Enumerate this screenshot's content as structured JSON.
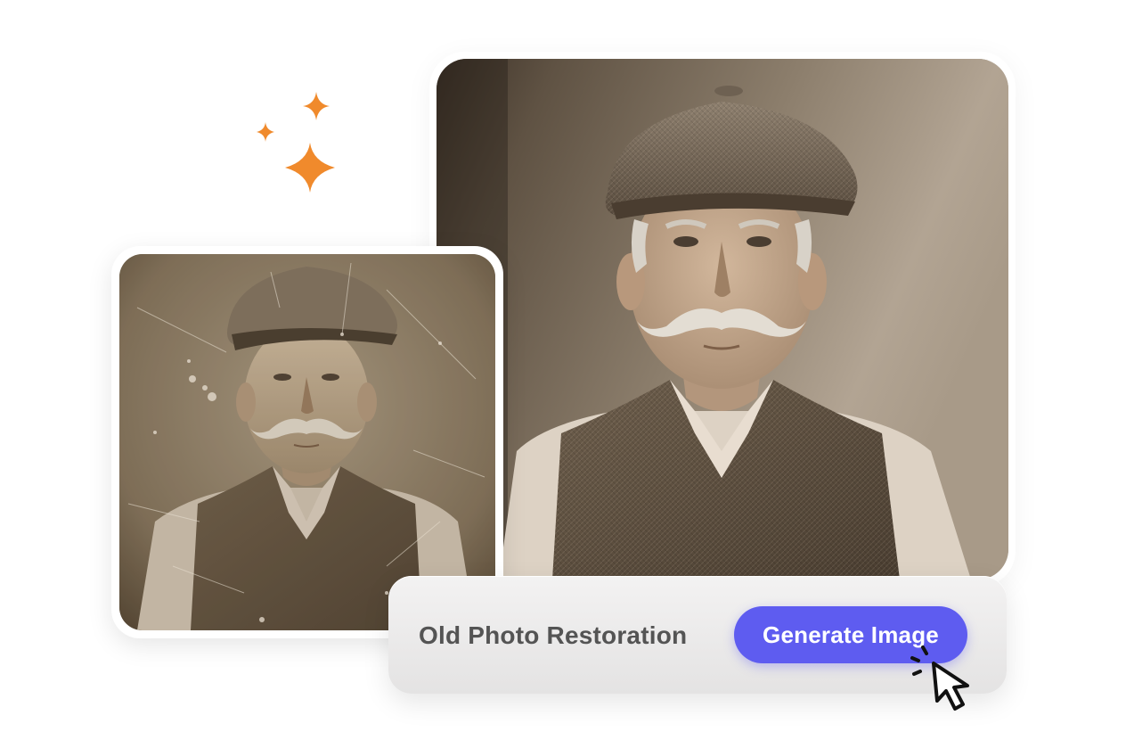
{
  "feature": {
    "label": "Old Photo Restoration",
    "button_label": "Generate Image"
  },
  "colors": {
    "accent": "#5e5cf0",
    "sparkle": "#f08a2c",
    "label_text": "#545454"
  },
  "icons": {
    "sparkles": "sparkle-icon",
    "cursor": "click-cursor-icon"
  },
  "images": {
    "original": "sepia portrait of elderly man with flat cap, mustache and tweed waistcoat, scratched and faded",
    "restored": "restored sepia portrait of elderly man with flat cap, mustache and tweed waistcoat"
  }
}
